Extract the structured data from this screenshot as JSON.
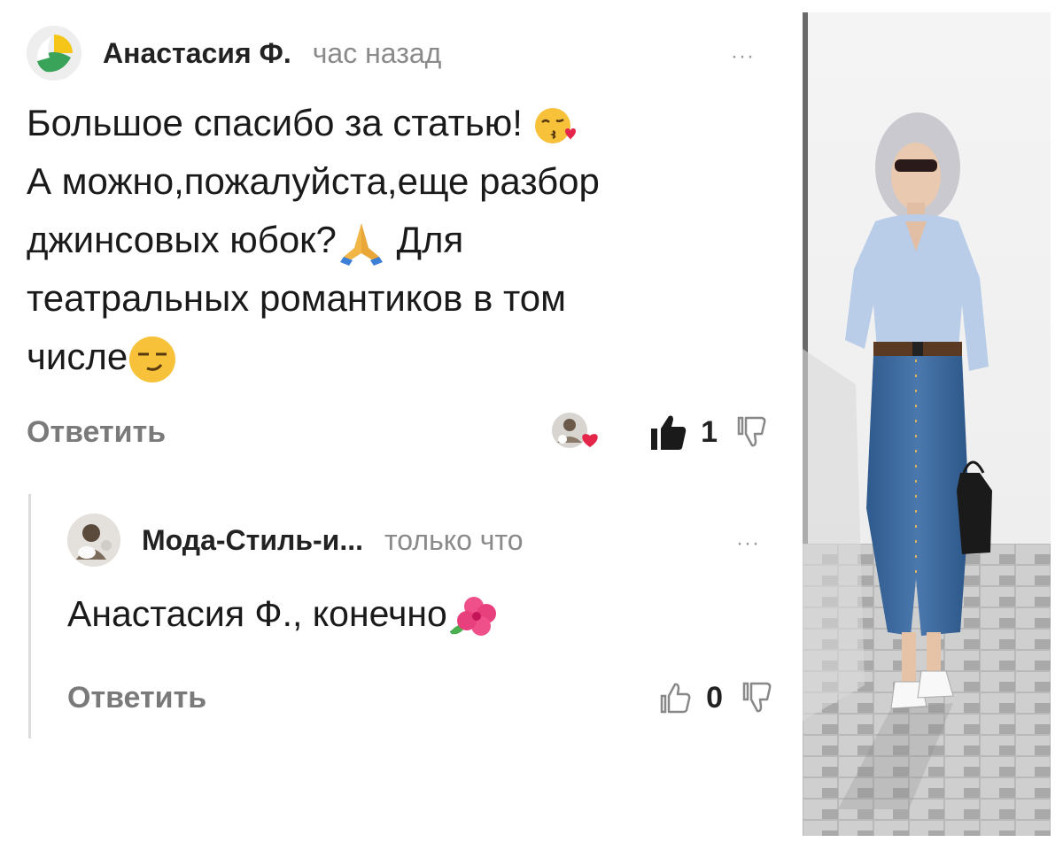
{
  "comments": [
    {
      "author": "Анастасия Ф.",
      "time": "час назад",
      "more": "···",
      "text_line1": "Большое спасибо за статью!",
      "text_line2": "А можно,пожалуйста,еще разбор",
      "text_line3a": "джинсовых юбок?",
      "text_line3b": " Для",
      "text_line4": "театральных романтиков в том",
      "text_line5": "числе",
      "reply_label": "Ответить",
      "likes": "1",
      "liked": true
    },
    {
      "author": "Мода-Стиль-и...",
      "time": "только что",
      "more": "···",
      "text": "Анастасия Ф., конечно",
      "reply_label": "Ответить",
      "likes": "0",
      "liked": false
    }
  ],
  "colors": {
    "accent_like": "#1a1a1a",
    "muted_text": "#8a8a8a",
    "thread_line": "#dcdcdc",
    "logo_yellow": "#f5c518",
    "logo_green": "#3aa35a"
  },
  "icons": [
    "logo-avatar-icon",
    "kiss-emoji-icon",
    "pray-emoji-icon",
    "smirk-emoji-icon",
    "hibiscus-emoji-icon",
    "thumbs-up-icon",
    "thumbs-down-icon",
    "heart-icon"
  ]
}
